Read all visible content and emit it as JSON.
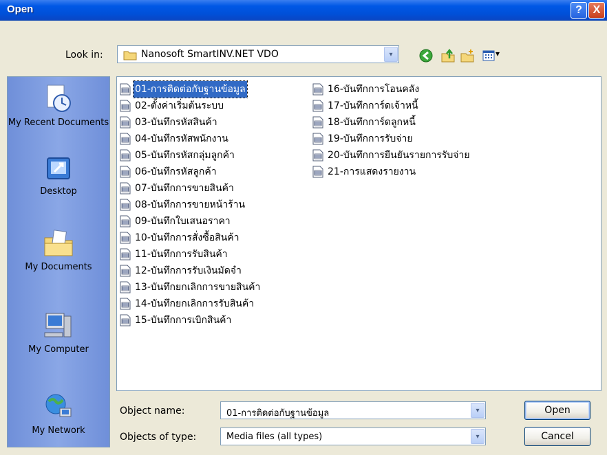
{
  "window": {
    "title": "Open"
  },
  "titlebar_buttons": {
    "help": "?",
    "close": "X"
  },
  "look_in": {
    "label": "Look in:",
    "value": "Nanosoft SmartINV.NET VDO",
    "arrow": "▾"
  },
  "toolbar": {
    "views_arrow": "▾"
  },
  "places": [
    {
      "label": "My Recent Documents"
    },
    {
      "label": "Desktop"
    },
    {
      "label": "My Documents"
    },
    {
      "label": "My Computer"
    },
    {
      "label": "My Network"
    }
  ],
  "files_col1": [
    "01-การติดต่อกับฐานข้อมูล",
    "02-ตั้งค่าเริ่มต้นระบบ",
    "03-บันทึกรหัสสินค้า",
    "04-บันทึกรหัสพนักงาน",
    "05-บันทึกรหัสกลุ่มลูกค้า",
    "06-บันทึกรหัสลูกค้า",
    "07-บันทึกการขายสินค้า",
    "08-บันทึกการขายหน้าร้าน",
    "09-บันทึกใบเสนอราคา",
    "10-บันทึกการสั่งซื้อสินค้า",
    "11-บันทึกการรับสินค้า",
    "12-บันทึกการรับเงินมัดจำ",
    "13-บันทึกยกเลิกการขายสินค้า",
    "14-บันทึกยกเลิกการรับสินค้า",
    "15-บันทึกการเบิกสินค้า"
  ],
  "files_col2": [
    "16-บันทึกการโอนคลัง",
    "17-บันทึกการ์ดเจ้าหนี้",
    "18-บันทึกการ์ดลูกหนี้",
    "19-บันทึกการรับจ่าย",
    "20-บันทึกการยืนยันรายการรับจ่าย",
    "21-การแสดงรายงาน"
  ],
  "object_name": {
    "label": "Object name:",
    "value": "01-การติดต่อกับฐานข้อมูล"
  },
  "object_type": {
    "label": "Objects of type:",
    "value": "Media files (all types)"
  },
  "buttons": {
    "open": "Open",
    "cancel": "Cancel"
  }
}
